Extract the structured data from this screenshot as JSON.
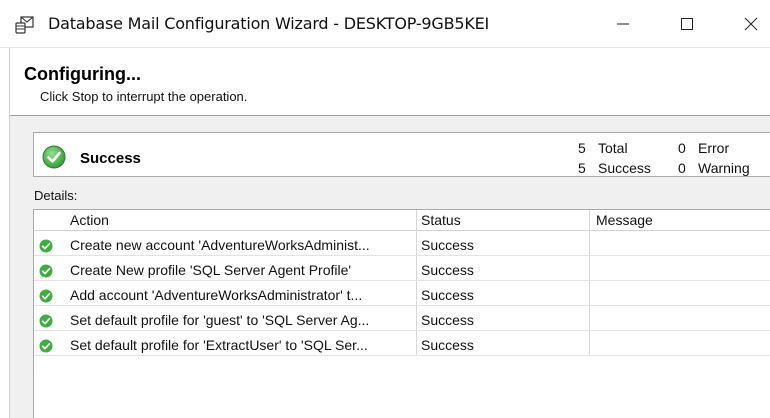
{
  "window": {
    "title": "Database Mail Configuration Wizard - DESKTOP-9GB5KEI",
    "icon": "database-mail-icon",
    "controls": {
      "minimize": "minimize-icon",
      "maximize": "maximize-icon",
      "close": "close-icon"
    }
  },
  "header": {
    "title": "Configuring...",
    "subtitle": "Click Stop to interrupt the operation."
  },
  "summary": {
    "status": "Success",
    "status_icon": "success-check-icon",
    "total_count": "5",
    "total_label": "Total",
    "success_count": "5",
    "success_label": "Success",
    "error_count": "0",
    "error_label": "Error",
    "warning_count": "0",
    "warning_label": "Warning"
  },
  "details": {
    "label": "Details:",
    "columns": [
      "Action",
      "Status",
      "Message"
    ],
    "rows": [
      {
        "action": "Create new account 'AdventureWorksAdminist...",
        "status": "Success",
        "message": ""
      },
      {
        "action": "Create New profile 'SQL Server Agent Profile'",
        "status": "Success",
        "message": ""
      },
      {
        "action": "Add account 'AdventureWorksAdministrator' t...",
        "status": "Success",
        "message": ""
      },
      {
        "action": "Set default profile for 'guest' to 'SQL Server Ag...",
        "status": "Success",
        "message": ""
      },
      {
        "action": "Set default profile for 'ExtractUser' to 'SQL Ser...",
        "status": "Success",
        "message": ""
      }
    ]
  },
  "colors": {
    "success_green": "#3fae3f",
    "border": "#a9a9a9",
    "panel_bg": "#f0f0f0"
  }
}
